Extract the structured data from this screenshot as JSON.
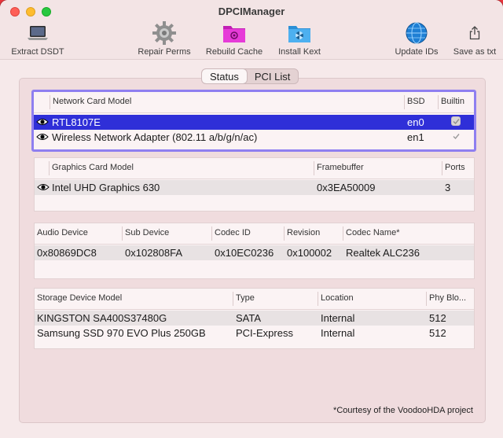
{
  "window": {
    "title": "DPCIManager"
  },
  "toolbar": {
    "extract": "Extract DSDT",
    "repair": "Repair Perms",
    "rebuild": "Rebuild Cache",
    "install": "Install Kext",
    "update": "Update IDs",
    "save": "Save as txt"
  },
  "tabs": {
    "status": "Status",
    "pci": "PCI List"
  },
  "network": {
    "headers": {
      "model": "Network Card Model",
      "bsd": "BSD",
      "builtin": "Builtin"
    },
    "rows": [
      {
        "model": "RTL8107E",
        "bsd": "en0",
        "builtin": true
      },
      {
        "model": "Wireless Network Adapter (802.11 a/b/g/n/ac)",
        "bsd": "en1",
        "builtin": true
      }
    ]
  },
  "graphics": {
    "headers": {
      "model": "Graphics Card Model",
      "fb": "Framebuffer",
      "ports": "Ports"
    },
    "rows": [
      {
        "model": "Intel UHD Graphics 630",
        "fb": "0x3EA50009",
        "ports": "3"
      }
    ]
  },
  "audio": {
    "headers": {
      "device": "Audio Device",
      "sub": "Sub Device",
      "codec": "Codec ID",
      "rev": "Revision",
      "name": "Codec Name*"
    },
    "rows": [
      {
        "device": "0x80869DC8",
        "sub": "0x102808FA",
        "codec": "0x10EC0236",
        "rev": "0x100002",
        "name": "Realtek ALC236"
      }
    ]
  },
  "storage": {
    "headers": {
      "model": "Storage Device Model",
      "type": "Type",
      "location": "Location",
      "phy": "Phy Blo..."
    },
    "rows": [
      {
        "model": "KINGSTON SA400S37480G",
        "type": "SATA",
        "location": "Internal",
        "phy": "512"
      },
      {
        "model": "Samsung SSD 970 EVO Plus 250GB",
        "type": "PCI-Express",
        "location": "Internal",
        "phy": "512"
      }
    ]
  },
  "footnote": "*Courtesy of the VoodooHDA project",
  "colors": {
    "selection": "#2f2fd8",
    "focus_ring": "#8f7ff0",
    "desktop": "#c2203a"
  }
}
